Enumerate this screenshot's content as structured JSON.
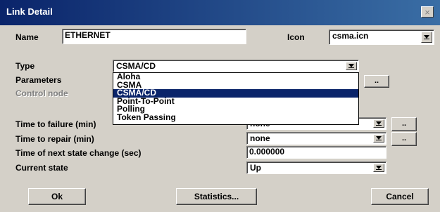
{
  "window": {
    "title": "Link Detail",
    "close_glyph": "×"
  },
  "name": {
    "label": "Name",
    "value": "ETHERNET"
  },
  "icon": {
    "label": "Icon",
    "value": "csma.icn"
  },
  "type": {
    "label": "Type",
    "value": "CSMA/CD",
    "options": [
      "Aloha",
      "CSMA",
      "CSMA/CD",
      "Point-To-Point",
      "Polling",
      "Token Passing"
    ],
    "selected_index": 2
  },
  "parameters": {
    "label": "Parameters",
    "button_label": ".."
  },
  "control_node": {
    "label": "Control node"
  },
  "time_to_failure": {
    "label": "Time to failure (min)",
    "value": "none",
    "button_label": ".."
  },
  "time_to_repair": {
    "label": "Time to repair (min)",
    "value": "none",
    "button_label": ".."
  },
  "next_state_change": {
    "label": "Time of next state change (sec)",
    "value": "0.000000"
  },
  "current_state": {
    "label": "Current state",
    "value": "Up"
  },
  "buttons": {
    "ok": "Ok",
    "statistics": "Statistics...",
    "cancel": "Cancel"
  },
  "colors": {
    "titlebar": "#0a246a",
    "face": "#d4d0c8",
    "highlight": "#0a246a"
  }
}
